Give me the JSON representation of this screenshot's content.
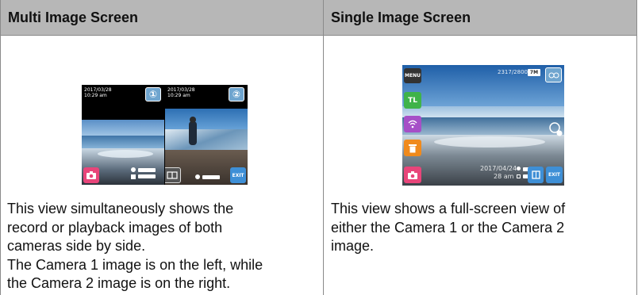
{
  "columns": [
    {
      "header": "Multi Image Screen",
      "description": [
        "This view simultaneously shows the",
        "record or playback images of both",
        "cameras side by side.",
        "The Camera 1 image is on the left, while",
        "the Camera 2 image is on the right."
      ],
      "screen": {
        "left_timestamp": [
          "2017/03/28",
          "10:29 am"
        ],
        "right_timestamp": [
          "2017/03/28",
          "10:29 am"
        ],
        "camera1_badge": "①",
        "camera2_badge": "②",
        "exit_label": "EXIT"
      }
    },
    {
      "header": "Single Image Screen",
      "description": [
        "This view shows a full-screen view of",
        "either the Camera 1 or the Camera 2",
        "image."
      ],
      "screen": {
        "menu_label": "MENU",
        "tl_label": "TL",
        "top_counter": "2317/2800",
        "top_badge": "7M",
        "bottom_date": "2017/04/24",
        "bottom_time": "28 am",
        "exit_label": "EXIT"
      }
    }
  ],
  "colors": {
    "header_bg": "#b7b7b7",
    "record_button": "#e8457a",
    "exit_button": "#3e8fd6",
    "menu_button": "#333333",
    "tl_button": "#3fb34a",
    "wifi_button": "#a64fc7",
    "trash_button": "#f08a1c"
  }
}
